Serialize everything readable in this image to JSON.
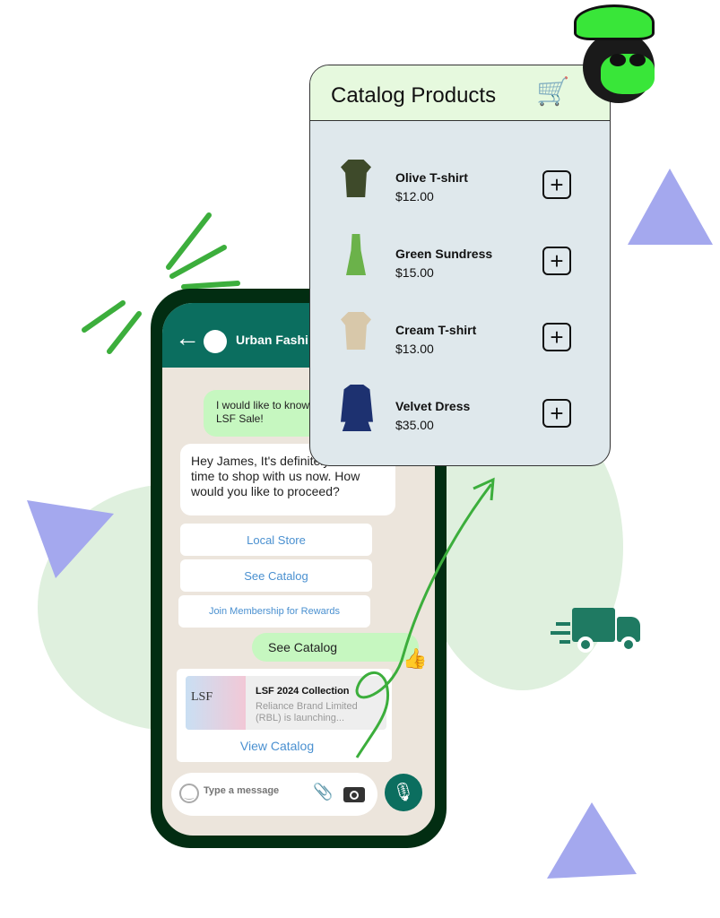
{
  "chat": {
    "contact": "Urban Fashi",
    "sent1": "I would like to know about your LSF Sale!",
    "received": "Hey James, It's definitely the best time to shop with us now. How would you like to proceed?",
    "options": [
      "Local Store",
      "See Catalog",
      "Join Membership for Rewards"
    ],
    "sent2": "See Catalog",
    "card": {
      "title": "LSF 2024 Collection",
      "desc": "Reliance Brand Limited (RBL) is launching...",
      "action": "View Catalog",
      "thumb_text": "LSF"
    },
    "input_placeholder": "Type a message"
  },
  "catalog": {
    "title": "Catalog Products",
    "items": [
      {
        "name": "Olive T-shirt",
        "price": "$12.00",
        "color": "#3e4a2a"
      },
      {
        "name": "Green Sundress",
        "price": "$15.00",
        "color": "#6bb24a"
      },
      {
        "name": "Cream T-shirt",
        "price": "$13.00",
        "color": "#d8c8aa"
      },
      {
        "name": "Velvet Dress",
        "price": "$35.00",
        "color": "#1d3170"
      }
    ]
  },
  "colors": {
    "phone": "#022d12",
    "header": "#0b6e5f",
    "accent": "#3cae3c",
    "triangle": "#a4a8ee"
  }
}
